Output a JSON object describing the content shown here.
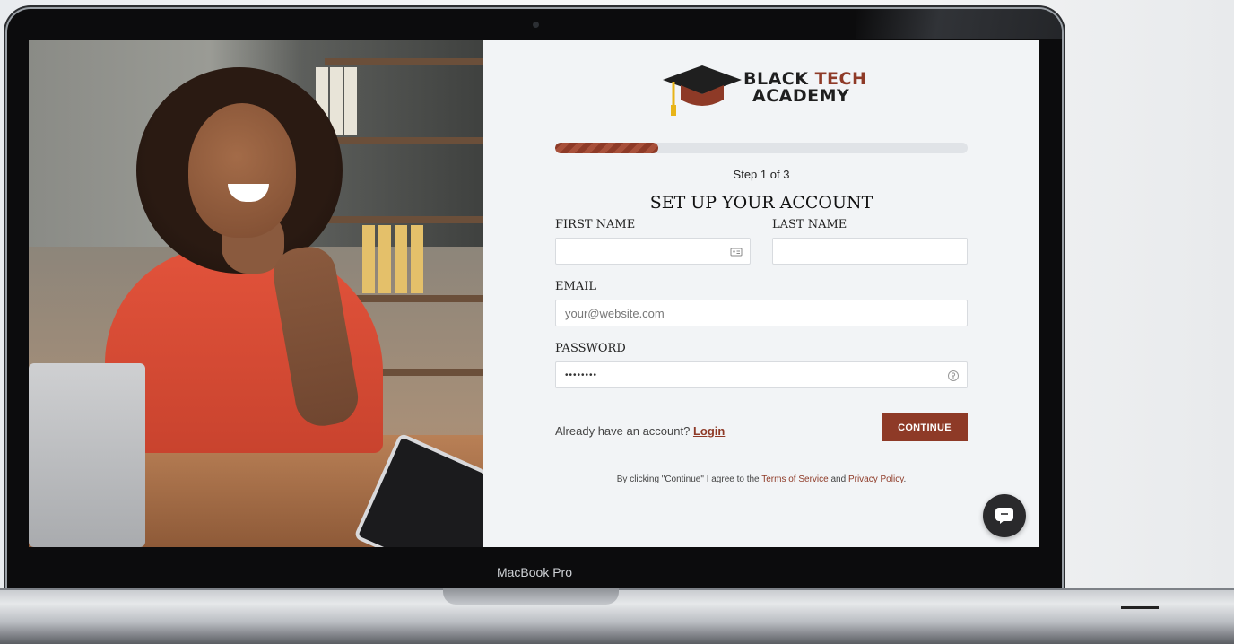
{
  "device": {
    "label": "MacBook Pro"
  },
  "brand": {
    "line1_a": "BLACK",
    "line1_b": "TECH",
    "line2": "ACADEMY",
    "accent": "#8e3a27"
  },
  "progress": {
    "value": 0.25,
    "step_text": "Step 1 of 3"
  },
  "form": {
    "title": "SET UP YOUR ACCOUNT",
    "first_name": {
      "label": "FIRST NAME",
      "value": ""
    },
    "last_name": {
      "label": "LAST NAME",
      "value": ""
    },
    "email": {
      "label": "EMAIL",
      "placeholder": "your@website.com"
    },
    "password": {
      "label": "PASSWORD",
      "value": "••••••••"
    }
  },
  "footer": {
    "already_text": "Already have an account?",
    "login_label": "Login",
    "continue_label": "CONTINUE",
    "terms_prefix": "By clicking \"Continue\" I agree to the",
    "terms_link": "Terms of Service",
    "terms_and": "and",
    "privacy_link": "Privacy Policy",
    "terms_suffix": "."
  },
  "icons": {
    "chat": "chat-bubble-icon",
    "contact_card": "contact-card-icon",
    "password_manager": "key-icon",
    "cap": "graduation-cap-icon"
  }
}
